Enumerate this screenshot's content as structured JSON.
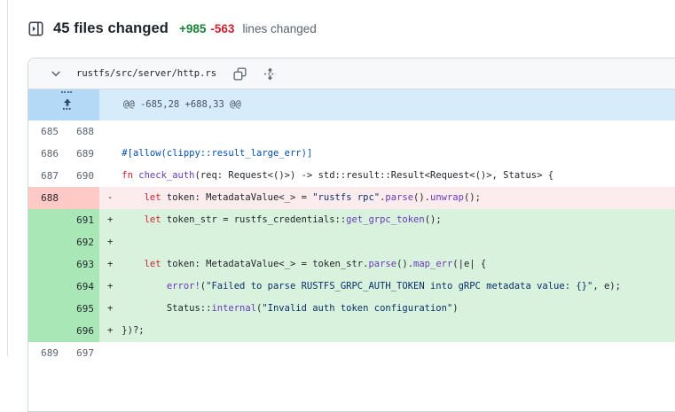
{
  "page": {
    "title": "45 files changed",
    "additions": "+985",
    "deletions": "-563",
    "suffix": "lines changed"
  },
  "file_header": {
    "path": "rustfs/src/server/http.rs",
    "icons": {
      "collapse": "chevron-down-icon",
      "copy": "copy-icon",
      "expand_all": "unfold-icon"
    }
  },
  "icons": {
    "file_tree_toggle": "panel-toggle-icon",
    "hunk_expand": "expand-up-icon"
  },
  "colors": {
    "addition_text": "#1a7f37",
    "deletion_text": "#cf222e",
    "muted_text": "#59636e",
    "border": "#d1d9e0",
    "file_head_bg": "#f6f8fa",
    "hunk_gutter_bg": "#b3d9f7",
    "hunk_bg": "#d6ecfb",
    "add_num_bg": "#a9e8b6",
    "add_line_bg": "#d9f2de",
    "del_num_bg": "#ffc9c5",
    "del_line_bg": "#fdecee"
  },
  "code_colors": {
    "k": "#cf222e",
    "f": "#6639ba",
    "s": "#0a3069",
    "a": "#0550ae",
    "p": "#1f2328"
  },
  "diff": {
    "rows": [
      {
        "type": "hunk",
        "text": "@@ -685,28 +688,33 @@"
      },
      {
        "type": "ctx",
        "old": "685",
        "new": "688",
        "segs": []
      },
      {
        "type": "ctx",
        "old": "686",
        "new": "689",
        "segs": [
          {
            "t": "    "
          },
          {
            "t": "#[allow(clippy::result_large_err)]",
            "c": "a"
          }
        ]
      },
      {
        "type": "ctx",
        "old": "687",
        "new": "690",
        "segs": [
          {
            "t": "    "
          },
          {
            "t": "fn",
            "c": "k"
          },
          {
            "t": " "
          },
          {
            "t": "check_auth",
            "c": "f"
          },
          {
            "t": "(req: Request<()>) -> std::result::Result<Request<()>, Status> {"
          }
        ]
      },
      {
        "type": "del",
        "old": "688",
        "new": "",
        "sign": "-",
        "segs": [
          {
            "t": "        "
          },
          {
            "t": "let",
            "c": "k"
          },
          {
            "t": " token: MetadataValue<_> = "
          },
          {
            "t": "\"rustfs rpc\"",
            "c": "s"
          },
          {
            "t": "."
          },
          {
            "t": "parse",
            "c": "f"
          },
          {
            "t": "()."
          },
          {
            "t": "unwrap",
            "c": "f"
          },
          {
            "t": "();"
          }
        ]
      },
      {
        "type": "add",
        "old": "",
        "new": "691",
        "sign": "+",
        "segs": [
          {
            "t": "        "
          },
          {
            "t": "let",
            "c": "k"
          },
          {
            "t": " token_str = rustfs_credentials::"
          },
          {
            "t": "get_grpc_token",
            "c": "f"
          },
          {
            "t": "();"
          }
        ]
      },
      {
        "type": "add",
        "old": "",
        "new": "692",
        "sign": "+",
        "segs": []
      },
      {
        "type": "add",
        "old": "",
        "new": "693",
        "sign": "+",
        "segs": [
          {
            "t": "        "
          },
          {
            "t": "let",
            "c": "k"
          },
          {
            "t": " token: MetadataValue<_> = token_str."
          },
          {
            "t": "parse",
            "c": "f"
          },
          {
            "t": "()."
          },
          {
            "t": "map_err",
            "c": "f"
          },
          {
            "t": "(|e| {"
          }
        ]
      },
      {
        "type": "add",
        "old": "",
        "new": "694",
        "sign": "+",
        "segs": [
          {
            "t": "            "
          },
          {
            "t": "error!",
            "c": "f"
          },
          {
            "t": "("
          },
          {
            "t": "\"Failed to parse RUSTFS_GRPC_AUTH_TOKEN into gRPC metadata value: {}\"",
            "c": "s"
          },
          {
            "t": ", e);"
          }
        ]
      },
      {
        "type": "add",
        "old": "",
        "new": "695",
        "sign": "+",
        "segs": [
          {
            "t": "            "
          },
          {
            "t": "Status::"
          },
          {
            "t": "internal",
            "c": "f"
          },
          {
            "t": "("
          },
          {
            "t": "\"Invalid auth token configuration\"",
            "c": "s"
          },
          {
            "t": ")"
          }
        ]
      },
      {
        "type": "add",
        "old": "",
        "new": "696",
        "sign": "+",
        "segs": [
          {
            "t": "    "
          },
          {
            "t": "})?;"
          }
        ]
      },
      {
        "type": "ctx",
        "old": "689",
        "new": "697",
        "segs": []
      }
    ]
  }
}
